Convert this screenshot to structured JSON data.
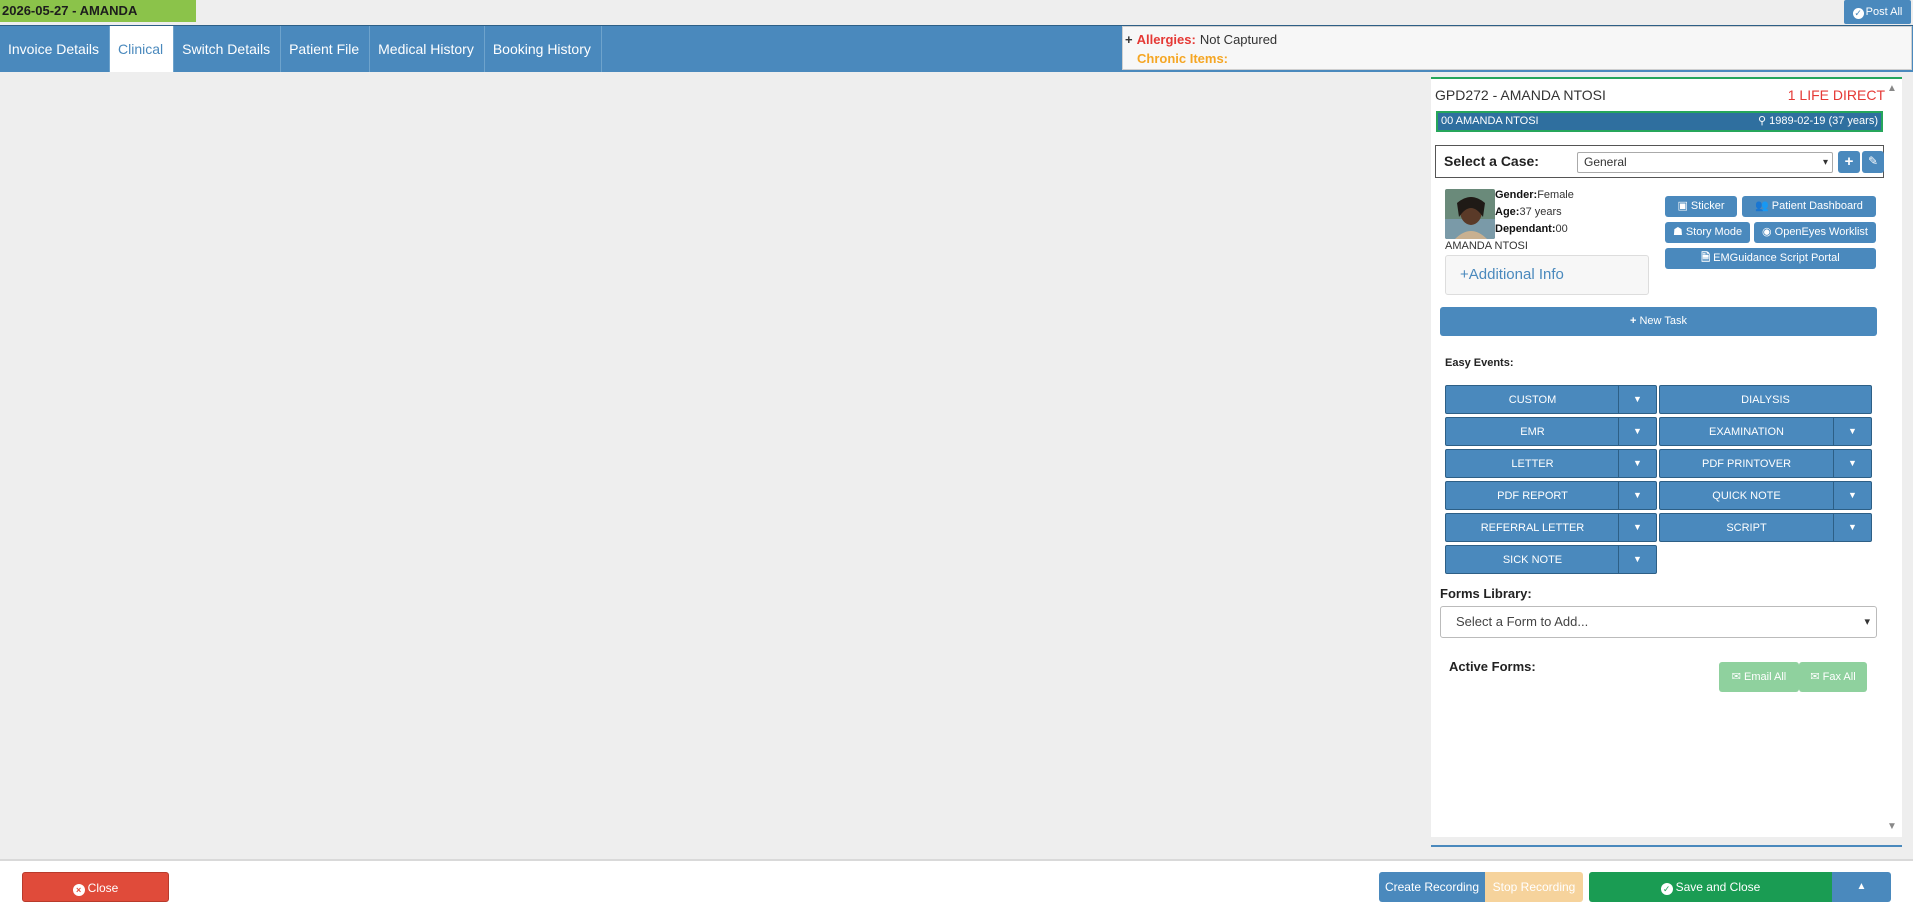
{
  "top": {
    "date_title": "2026-05-27 - AMANDA",
    "post_all": "Post All"
  },
  "tabs": [
    {
      "label": "Invoice Details"
    },
    {
      "label": "Clinical"
    },
    {
      "label": "Switch Details"
    },
    {
      "label": "Patient File"
    },
    {
      "label": "Medical History"
    },
    {
      "label": "Booking History"
    }
  ],
  "alerts": {
    "plus": "+",
    "allergies_label": "Allergies:",
    "allergies_value": "Not Captured",
    "chronic_label": "Chronic Items:"
  },
  "patient": {
    "header_left": "GPD272 - AMANDA NTOSI",
    "header_right": "1 LIFE DIRECT",
    "bar_left": "00 AMANDA NTOSI",
    "bar_right": "1989-02-19 (37 years)",
    "gender_label": "Gender:",
    "gender": "Female",
    "age_label": "Age:",
    "age": "37 years",
    "dependant_label": "Dependant:",
    "dependant": "00",
    "name": "AMANDA NTOSI",
    "additional_info": "Additional Info"
  },
  "case": {
    "label": "Select a Case:",
    "selected": "General"
  },
  "actions": {
    "sticker": "Sticker",
    "patient_dashboard": "Patient Dashboard",
    "story_mode": "Story Mode",
    "openeyes_worklist": "OpenEyes Worklist",
    "emguidance": "EMGuidance Script Portal",
    "new_task": "New Task"
  },
  "easy_events": {
    "label": "Easy Events:",
    "items": [
      {
        "label": "CUSTOM",
        "dropdown": true
      },
      {
        "label": "DIALYSIS",
        "dropdown": false
      },
      {
        "label": "EMR",
        "dropdown": true
      },
      {
        "label": "EXAMINATION",
        "dropdown": true
      },
      {
        "label": "LETTER",
        "dropdown": true
      },
      {
        "label": "PDF PRINTOVER",
        "dropdown": true
      },
      {
        "label": "PDF REPORT",
        "dropdown": true
      },
      {
        "label": "QUICK NOTE",
        "dropdown": true
      },
      {
        "label": "REFERRAL LETTER",
        "dropdown": true
      },
      {
        "label": "SCRIPT",
        "dropdown": true
      },
      {
        "label": "SICK NOTE",
        "dropdown": true
      }
    ]
  },
  "forms": {
    "label": "Forms Library:",
    "placeholder": "Select a Form to Add...",
    "active_label": "Active Forms:",
    "email_all": "Email All",
    "fax_all": "Fax All"
  },
  "footer": {
    "close": "Close",
    "create_recording": "Create Recording",
    "stop_recording": "Stop Recording",
    "save_and_close": "Save and Close"
  },
  "colors": {
    "primary": "#4a89bd",
    "date_badge": "#8bc34a",
    "danger": "#e04b3a",
    "success": "#1a9c53",
    "warning_light": "#f6d39c",
    "allergy_red": "#e53935",
    "chronic_orange": "#f5a623"
  }
}
